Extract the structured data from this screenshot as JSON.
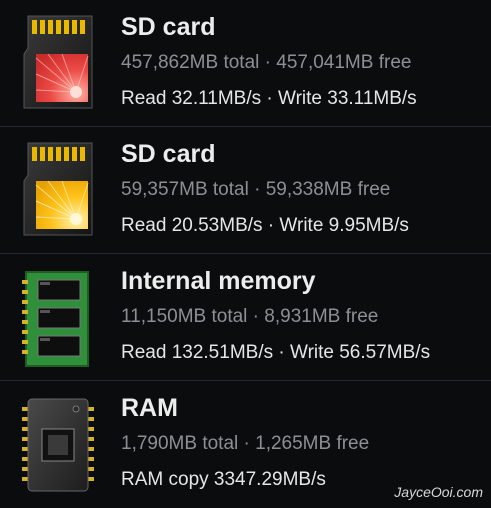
{
  "items": [
    {
      "title": "SD card",
      "capacity": "457,862MB total · 457,041MB free",
      "speed": "Read 32.11MB/s · Write 33.11MB/s",
      "icon": "sd-card-red-icon",
      "icon_color": "#e23a3a"
    },
    {
      "title": "SD card",
      "capacity": "59,357MB total · 59,338MB free",
      "speed": "Read 20.53MB/s · Write 9.95MB/s",
      "icon": "sd-card-yellow-icon",
      "icon_color": "#f5b800"
    },
    {
      "title": "Internal memory",
      "capacity": "11,150MB total · 8,931MB free",
      "speed": "Read 132.51MB/s · Write 56.57MB/s",
      "icon": "memory-module-icon",
      "icon_color": "#2f8f3a"
    },
    {
      "title": "RAM",
      "capacity": "1,790MB total · 1,265MB free",
      "speed": "RAM copy 3347.29MB/s",
      "icon": "ram-chip-icon",
      "icon_color": "#3a3a3a"
    }
  ],
  "watermark": "JayceOoi.com"
}
